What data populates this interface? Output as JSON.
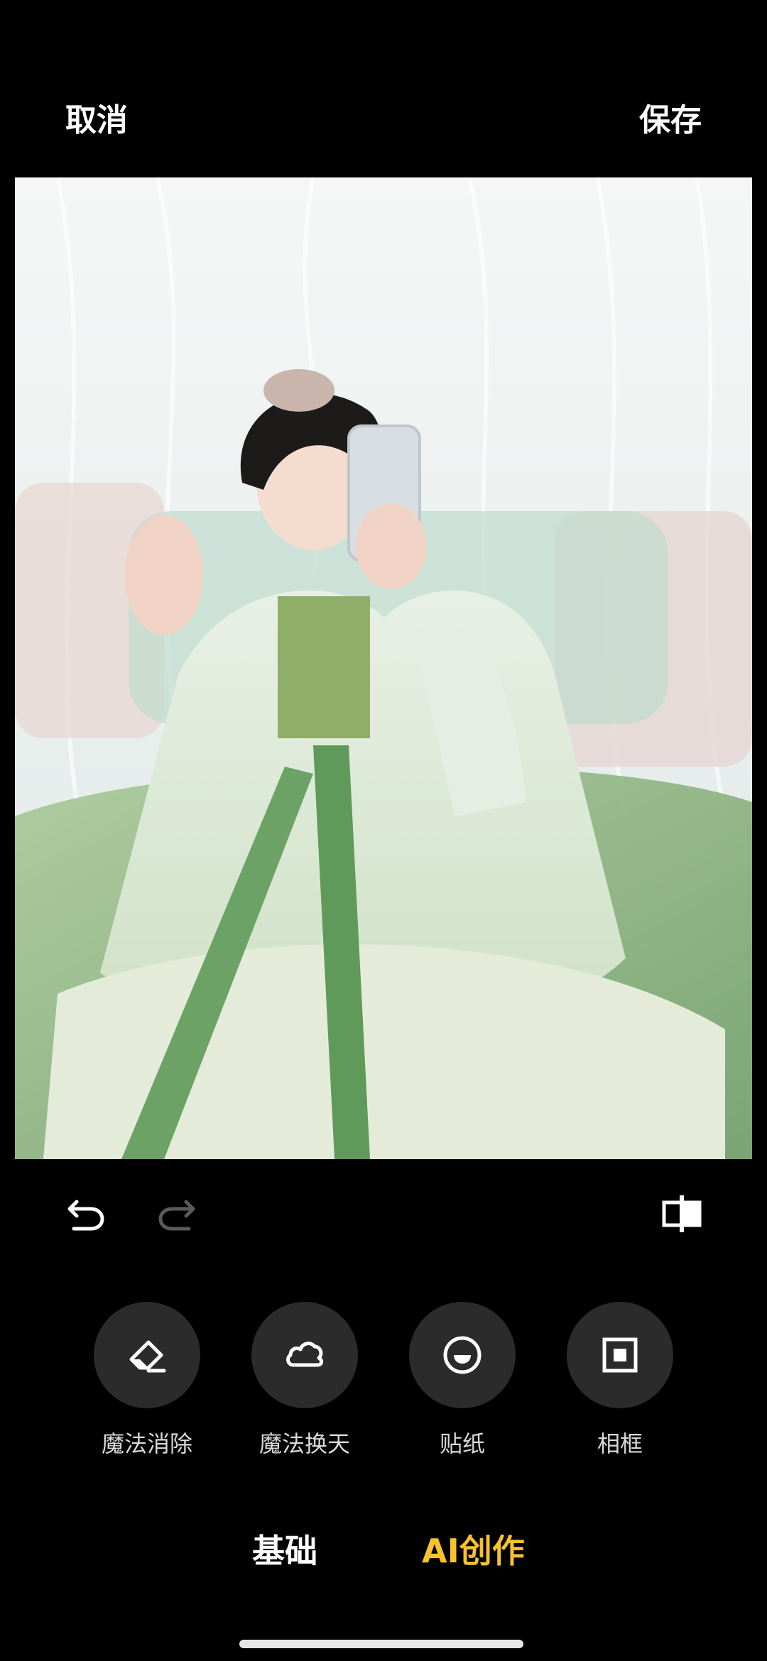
{
  "topbar": {
    "cancel_label": "取消",
    "save_label": "保存"
  },
  "photo": {
    "description_icon": "photo-canvas"
  },
  "editbar": {
    "undo_icon": "undo-icon",
    "redo_icon": "redo-icon",
    "compare_icon": "compare-icon"
  },
  "tools": [
    {
      "label": "魔法消除",
      "icon": "eraser-icon"
    },
    {
      "label": "魔法换天",
      "icon": "cloud-icon"
    },
    {
      "label": "贴纸",
      "icon": "sticker-icon"
    },
    {
      "label": "相框",
      "icon": "frame-icon"
    }
  ],
  "tabs": {
    "basic_label": "基础",
    "ai_label": "AI创作"
  },
  "colors": {
    "accent": "#f7c22b",
    "tool_bg": "#2b2b2b",
    "background": "#000000"
  }
}
